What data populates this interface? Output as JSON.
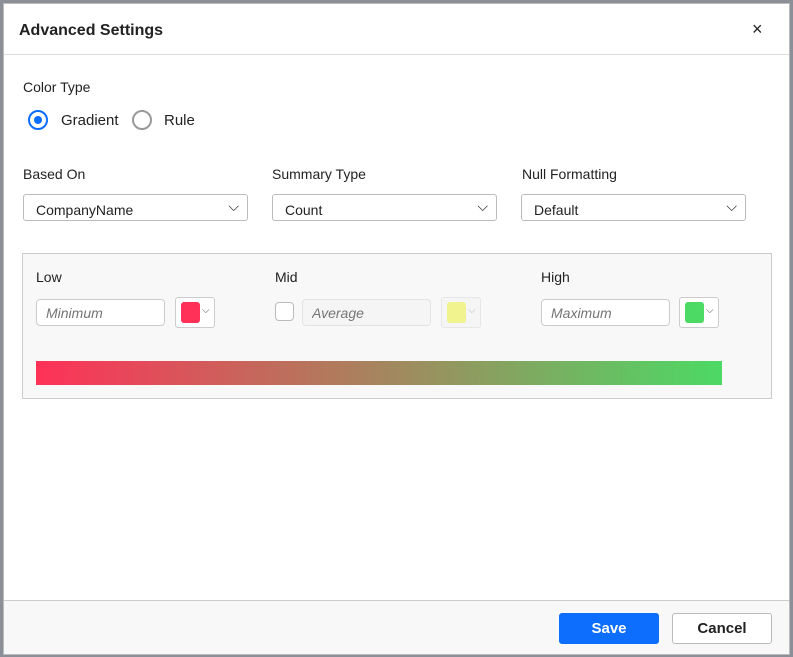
{
  "dialog": {
    "title": "Advanced Settings",
    "close": "×"
  },
  "color_type": {
    "label": "Color Type",
    "options": [
      {
        "label": "Gradient",
        "selected": true
      },
      {
        "label": "Rule",
        "selected": false
      }
    ]
  },
  "based_on": {
    "label": "Based On",
    "value": "CompanyName"
  },
  "summary_type": {
    "label": "Summary Type",
    "value": "Count"
  },
  "null_formatting": {
    "label": "Null Formatting",
    "value": "Default"
  },
  "gradient": {
    "low": {
      "label": "Low",
      "placeholder": "Minimum",
      "color": "#ff3158"
    },
    "mid": {
      "label": "Mid",
      "placeholder": "Average",
      "color": "#f0f38e",
      "enabled": false
    },
    "high": {
      "label": "High",
      "placeholder": "Maximum",
      "color": "#4cd964"
    }
  },
  "chevron": "⌵",
  "footer": {
    "save": "Save",
    "cancel": "Cancel"
  }
}
